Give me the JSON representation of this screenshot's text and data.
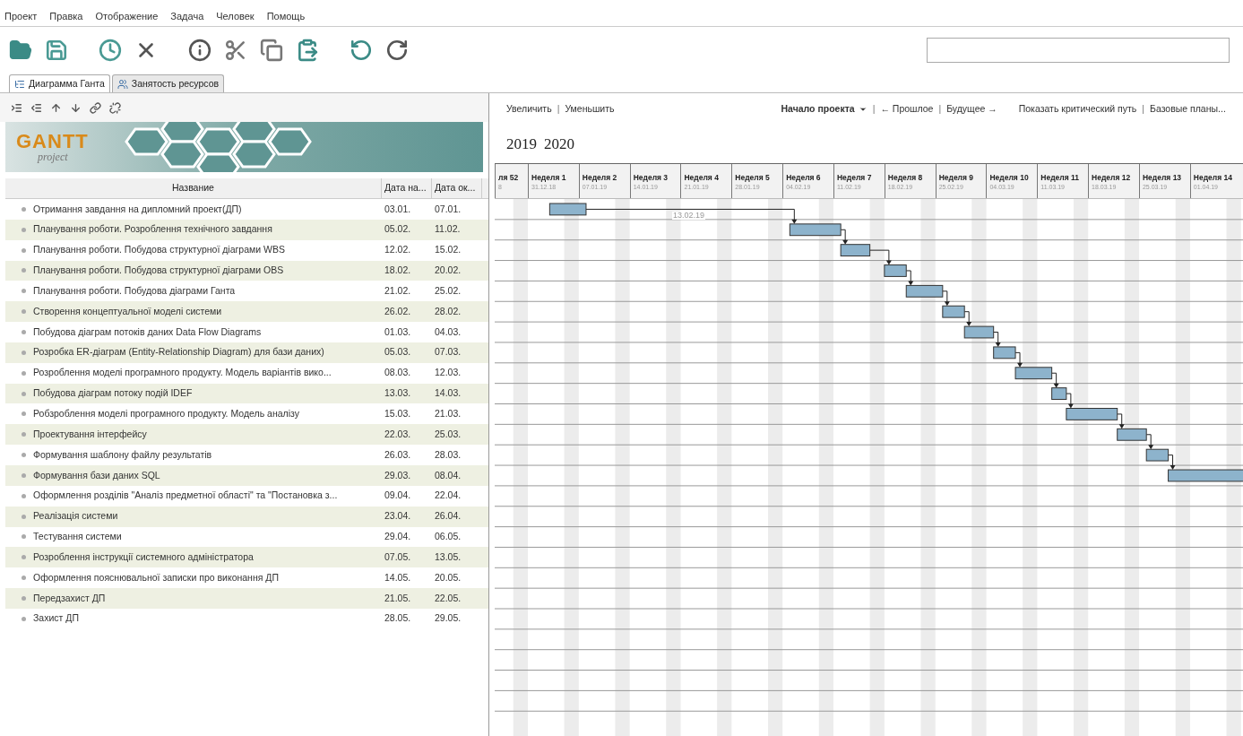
{
  "menu": [
    "Проект",
    "Правка",
    "Отображение",
    "Задача",
    "Человек",
    "Помощь"
  ],
  "tabs": [
    {
      "label": "Диаграмма Ганта",
      "selected": true
    },
    {
      "label": "Занятость ресурсов",
      "selected": false
    }
  ],
  "logo": {
    "title": "GANTT",
    "subtitle": "project"
  },
  "columns": [
    "Название",
    "Дата на...",
    "Дата ок..."
  ],
  "tasks": [
    {
      "name": "Отримання завдання на дипломний проект(ДП)",
      "start": "03.01.",
      "end": "07.01.",
      "links_to_next": true
    },
    {
      "name": "Планування роботи. Розроблення технічного завдання",
      "start": "05.02.",
      "end": "11.02.",
      "links_to_next": true
    },
    {
      "name": "Планування роботи. Побудова структурної діаграми WBS",
      "start": "12.02.",
      "end": "15.02.",
      "links_to_next": true
    },
    {
      "name": "Планування роботи. Побудова структурної діаграми OBS",
      "start": "18.02.",
      "end": "20.02.",
      "links_to_next": true
    },
    {
      "name": "Планування роботи. Побудова діаграми Ганта",
      "start": "21.02.",
      "end": "25.02.",
      "links_to_next": true
    },
    {
      "name": "Створення концептуальної моделі системи",
      "start": "26.02.",
      "end": "28.02.",
      "links_to_next": true
    },
    {
      "name": "Побудова діаграм потоків даних Data Flow Diagrams",
      "start": "01.03.",
      "end": "04.03.",
      "links_to_next": true
    },
    {
      "name": "Розробка ER-діаграм (Entity-Relationship Diagram) для бази даних)",
      "start": "05.03.",
      "end": "07.03.",
      "links_to_next": true
    },
    {
      "name": "Розроблення моделі програмного продукту. Модель варіантів вико...",
      "start": "08.03.",
      "end": "12.03.",
      "links_to_next": true
    },
    {
      "name": "Побудова діаграм потоку подій IDEF",
      "start": "13.03.",
      "end": "14.03.",
      "links_to_next": true
    },
    {
      "name": "Робзроблення моделі програмного продукту. Модель аналізу",
      "start": "15.03.",
      "end": "21.03.",
      "links_to_next": true
    },
    {
      "name": "Проектування інтерфейсу",
      "start": "22.03.",
      "end": "25.03.",
      "links_to_next": true
    },
    {
      "name": "Формування шаблону файлу результатів",
      "start": "26.03.",
      "end": "28.03.",
      "links_to_next": true
    },
    {
      "name": "Формування бази даних SQL",
      "start": "29.03.",
      "end": "08.04."
    },
    {
      "name": "Оформлення розділів \"Аналіз предметної області\" та \"Постановка з...",
      "start": "09.04.",
      "end": "22.04."
    },
    {
      "name": "Реалізація системи",
      "start": "23.04.",
      "end": "26.04."
    },
    {
      "name": "Тестування системи",
      "start": "29.04.",
      "end": "06.05."
    },
    {
      "name": "Розроблення інструкції системного адміністратора",
      "start": "07.05.",
      "end": "13.05."
    },
    {
      "name": "Оформлення пояснювальної записки про виконання ДП",
      "start": "14.05.",
      "end": "20.05."
    },
    {
      "name": "Передзахист ДП",
      "start": "21.05.",
      "end": "22.05."
    },
    {
      "name": "Захист ДП",
      "start": "28.05.",
      "end": "29.05."
    }
  ],
  "chart_toolbar": [
    {
      "kind": "link",
      "label": "Увеличить"
    },
    {
      "kind": "separator",
      "label": "|"
    },
    {
      "kind": "link",
      "label": "Уменьшить"
    },
    {
      "kind": "spacer"
    },
    {
      "kind": "dropdown",
      "label": "Начало проекта"
    },
    {
      "kind": "separator",
      "label": "|"
    },
    {
      "kind": "link",
      "label": "← Прошлое"
    },
    {
      "kind": "separator",
      "label": "|"
    },
    {
      "kind": "link",
      "label": "Будущее →"
    },
    {
      "kind": "gap"
    },
    {
      "kind": "link",
      "label": "Показать критический путь"
    },
    {
      "kind": "separator",
      "label": "|"
    },
    {
      "kind": "link",
      "label": "Базовые планы..."
    }
  ],
  "years": [
    "2019",
    "2020"
  ],
  "weeks": [
    {
      "label": "ля 52",
      "date": "8"
    },
    {
      "label": "Неделя 1",
      "date": "31.12.18"
    },
    {
      "label": "Неделя 2",
      "date": "07.01.19"
    },
    {
      "label": "Неделя 3",
      "date": "14.01.19"
    },
    {
      "label": "Неделя 4",
      "date": "21.01.19"
    },
    {
      "label": "Неделя 5",
      "date": "28.01.19"
    },
    {
      "label": "Неделя 6",
      "date": "04.02.19"
    },
    {
      "label": "Неделя 7",
      "date": "11.02.19"
    },
    {
      "label": "Неделя 8",
      "date": "18.02.19"
    },
    {
      "label": "Неделя 9",
      "date": "25.02.19"
    },
    {
      "label": "Неделя 10",
      "date": "04.03.19"
    },
    {
      "label": "Неделя 11",
      "date": "11.03.19"
    },
    {
      "label": "Неделя 12",
      "date": "18.03.19"
    },
    {
      "label": "Неделя 13",
      "date": "25.03.19"
    },
    {
      "label": "Неделя 14",
      "date": "01.04.19"
    }
  ],
  "marker": {
    "label": "13.02.19"
  }
}
